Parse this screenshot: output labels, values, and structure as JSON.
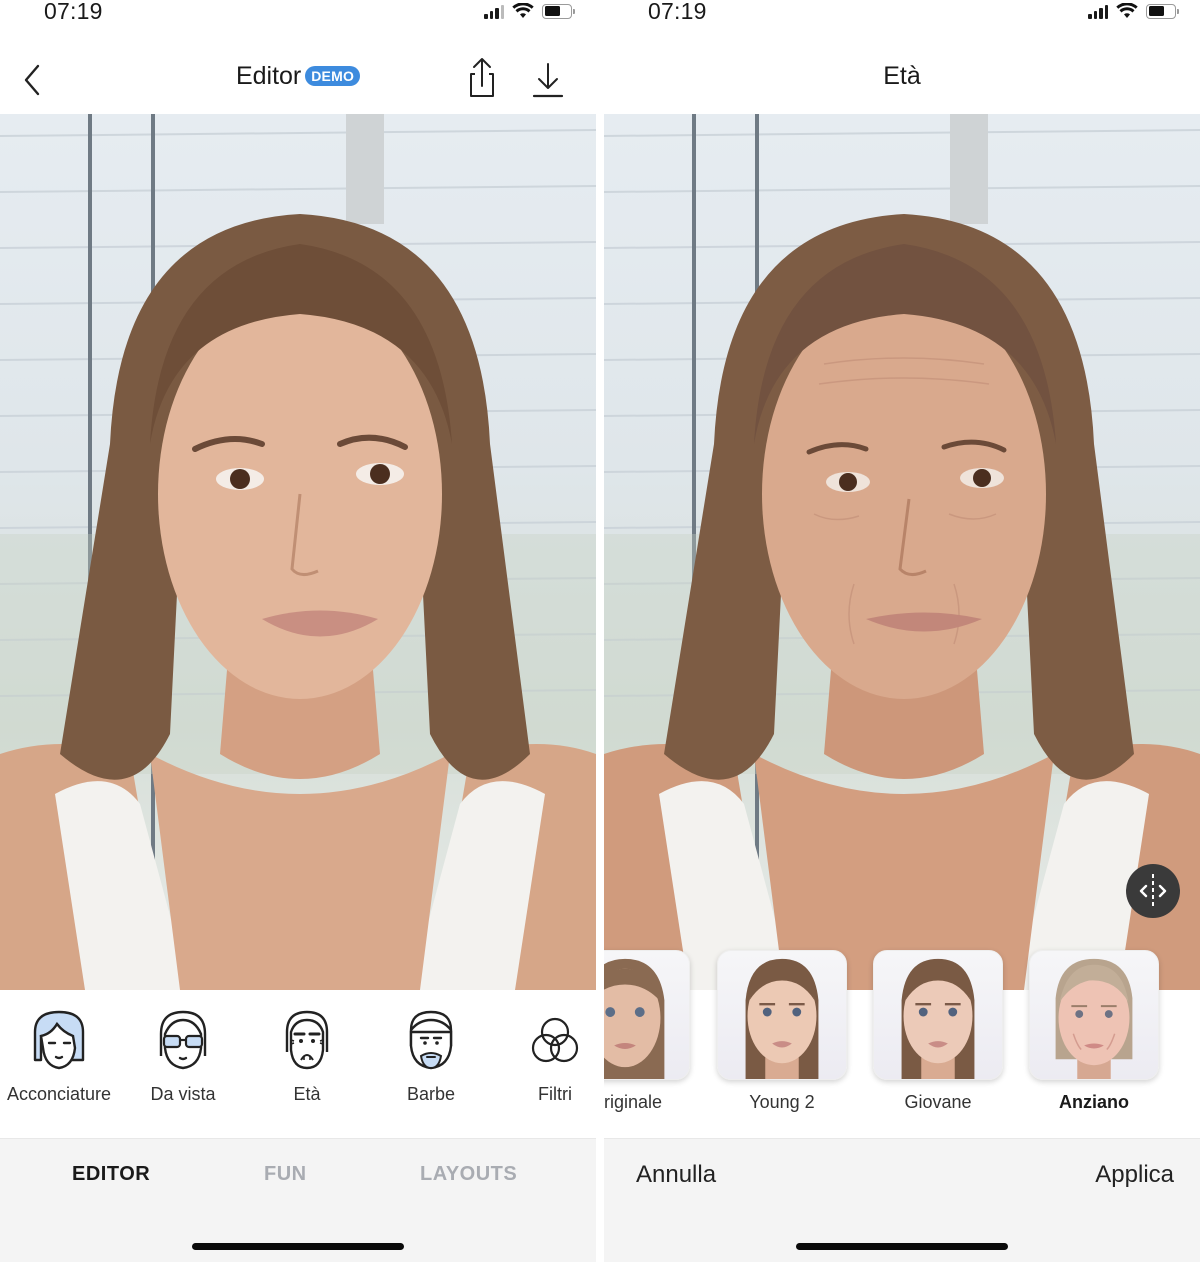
{
  "status_bar": {
    "left_time": "07:19",
    "right_time": "07:19",
    "battery_level": 0.6,
    "signal_bars": 4
  },
  "editor_screen": {
    "title": "Editor",
    "badge": "DEMO",
    "back_icon": "chevron-left-icon",
    "share_icon": "share-icon",
    "download_icon": "download-icon",
    "tools": [
      {
        "label": "Acconciature",
        "icon": "hairstyle-face-icon"
      },
      {
        "label": "Da vista",
        "icon": "glasses-face-icon"
      },
      {
        "label": "Età",
        "icon": "old-face-icon"
      },
      {
        "label": "Barbe",
        "icon": "beard-face-icon"
      },
      {
        "label": "Filtri",
        "icon": "filters-circles-icon"
      }
    ],
    "tabs": [
      {
        "label": "EDITOR",
        "active": true
      },
      {
        "label": "FUN",
        "active": false
      },
      {
        "label": "LAYOUTS",
        "active": false
      }
    ]
  },
  "age_screen": {
    "title": "Età",
    "compare_icon": "compare-slider-icon",
    "presets": [
      {
        "label": "Originale",
        "visible_label": "riginale",
        "selected": false
      },
      {
        "label": "Young 2",
        "selected": false
      },
      {
        "label": "Giovane",
        "selected": false
      },
      {
        "label": "Anziano",
        "selected": true
      }
    ],
    "cancel_label": "Annulla",
    "apply_label": "Applica"
  },
  "colors": {
    "badge_blue": "#3d8bde",
    "icon_fill_blue": "#c7dcf5",
    "inactive_tab": "#a9acb2",
    "tab_bar_bg": "#f4f4f4"
  }
}
